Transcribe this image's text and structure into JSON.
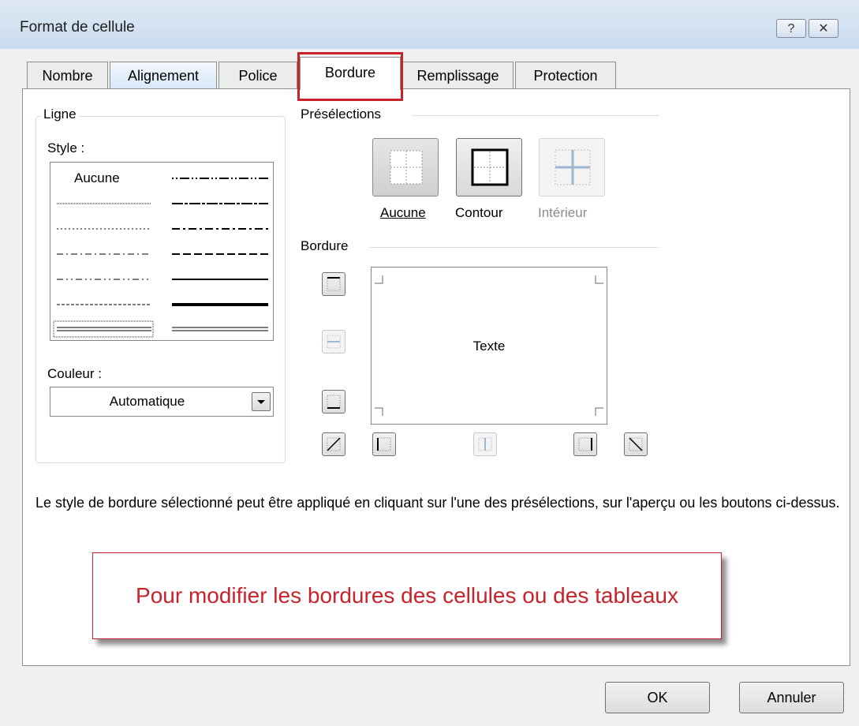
{
  "window": {
    "title": "Format de cellule",
    "help_glyph": "?",
    "close_glyph": "✕"
  },
  "tabs": [
    "Nombre",
    "Alignement",
    "Police",
    "Bordure",
    "Remplissage",
    "Protection"
  ],
  "active_tab": "Bordure",
  "line_group": {
    "label": "Ligne",
    "style_label": "Style :",
    "style_none": "Aucune",
    "color_label": "Couleur :",
    "color_value": "Automatique"
  },
  "presets": {
    "label": "Présélections",
    "none": "Aucune",
    "outline": "Contour",
    "inside": "Intérieur"
  },
  "border": {
    "label": "Bordure",
    "preview_text": "Texte"
  },
  "hint": "Le style de bordure sélectionné peut être appliqué en cliquant sur l'une des présélections, sur l'aperçu ou les boutons ci-dessus.",
  "callout": "Pour modifier les bordures des cellules ou des tableaux",
  "buttons": {
    "ok": "OK",
    "cancel": "Annuler"
  },
  "colors": {
    "accent_red": "#c8222b",
    "title_bar": "#c9dbee"
  }
}
